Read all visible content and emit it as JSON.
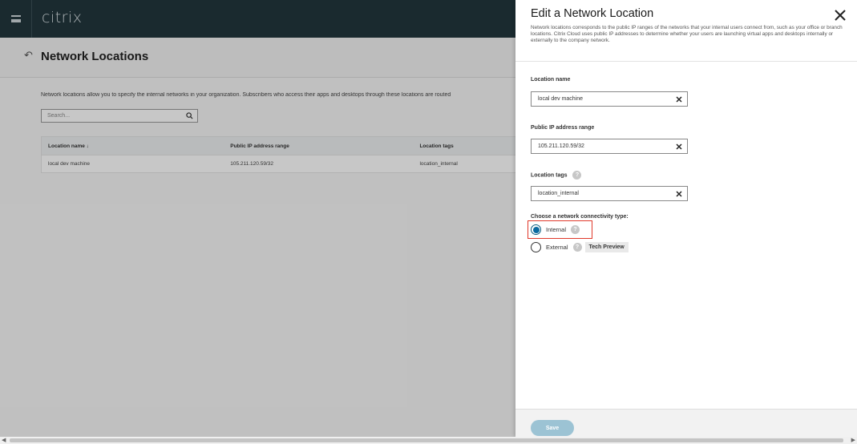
{
  "topbar": {
    "logo": "citrix"
  },
  "header": {
    "back_icon": "back-arrow-icon",
    "title": "Network Locations"
  },
  "main": {
    "description": "Network locations allow you to specify the internal networks in your organization. Subscribers who access their apps and desktops through these locations are routed",
    "search_placeholder": "Search...",
    "table": {
      "columns": [
        "Location name ↓",
        "Public IP address range",
        "Location tags"
      ],
      "rows": [
        {
          "name": "local dev machine",
          "ip": "105.211.120.59/32",
          "tags": "location_internal"
        }
      ]
    }
  },
  "panel": {
    "title": "Edit a Network Location",
    "description": "Network locations corresponds to the public IP ranges of the networks that your internal users connect from, such as your office or branch locations. Citrix Cloud uses public IP addresses to determine whether your users are launching virtual apps and desktops internally or externally to the company network.",
    "location_name": {
      "label": "Location name",
      "value": "local dev machine"
    },
    "ip_range": {
      "label": "Public IP address range",
      "value": "105.211.120.59/32"
    },
    "tags": {
      "label": "Location tags",
      "value": "location_internal"
    },
    "connectivity": {
      "label": "Choose a network connectivity type:",
      "options": [
        {
          "label": "Internal",
          "selected": true
        },
        {
          "label": "External",
          "selected": false,
          "badge": "Tech Preview"
        }
      ]
    },
    "save_label": "Save"
  },
  "colors": {
    "topbar": "#22363d",
    "accent": "#0b6aa0",
    "highlight": "#e0392b",
    "save": "#9cc3d4"
  }
}
